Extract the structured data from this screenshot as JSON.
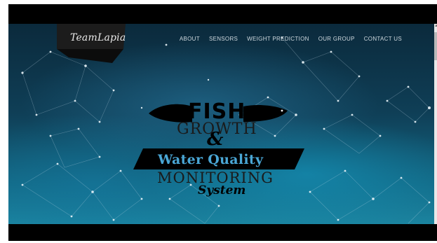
{
  "header": {
    "logo_text": "TeamLapia"
  },
  "nav": {
    "items": [
      {
        "label": "ABOUT"
      },
      {
        "label": "SENSORS"
      },
      {
        "label": "WEIGHT PREDICTION"
      },
      {
        "label": "OUR GROUP"
      },
      {
        "label": "CONTACT US"
      }
    ]
  },
  "hero": {
    "line1": "FISH",
    "line2": "GROWTH",
    "line3": "&",
    "line4": "Water Quality",
    "line5": "MONITORING",
    "line6": "System"
  },
  "colors": {
    "accent_text": "#4aa7d6",
    "background": "#0f3f57"
  }
}
